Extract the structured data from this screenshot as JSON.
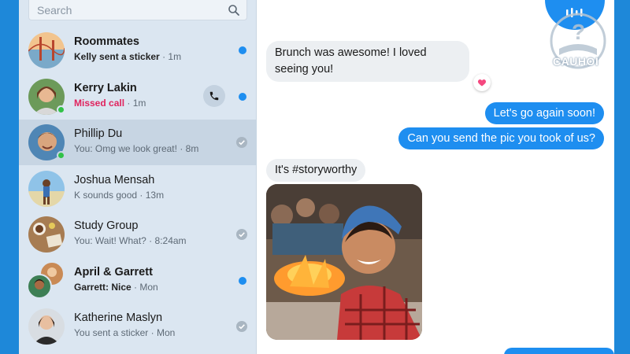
{
  "search": {
    "placeholder": "Search"
  },
  "conversations": [
    {
      "name": "Roommates",
      "preview": "Kelly sent a sticker",
      "time": "1m",
      "unread": true,
      "bold": true
    },
    {
      "name": "Kerry Lakin",
      "preview": "Missed call",
      "time": "1m",
      "unread": true,
      "bold": true,
      "online": true,
      "missed": true
    },
    {
      "name": "Phillip Du",
      "preview": "You: Omg we look great!",
      "time": "8m",
      "unread": false,
      "read": true,
      "online": true,
      "selected": true
    },
    {
      "name": "Joshua Mensah",
      "preview": "K sounds good",
      "time": "13m",
      "unread": false
    },
    {
      "name": "Study Group",
      "preview": "You: Wait! What?",
      "time": "8:24am",
      "unread": false,
      "read": true
    },
    {
      "name": "April & Garrett",
      "preview": "Garrett: Nice",
      "time": "Mon",
      "unread": true,
      "bold": true
    },
    {
      "name": "Katherine Maslyn",
      "preview": "You sent a sticker",
      "time": "Mon",
      "unread": false,
      "read": true
    }
  ],
  "separator": "·",
  "chat": {
    "messages": [
      {
        "direction": "in",
        "text": "Brunch was awesome! I loved seeing you!",
        "reaction": "heart-icon"
      },
      {
        "direction": "out",
        "text": "Let's go again soon!"
      },
      {
        "direction": "out",
        "text": "Can you send the pic you took of us?"
      },
      {
        "direction": "in",
        "text": "It's #storyworthy"
      }
    ]
  },
  "watermark": {
    "text": "CAUHOI"
  },
  "colors": {
    "accent": "#1e8ef0",
    "background": "#1e88d9",
    "sidebar": "#dbe6f1",
    "selected": "#c7d5e3",
    "missed": "#e0245e",
    "online": "#31c248"
  }
}
